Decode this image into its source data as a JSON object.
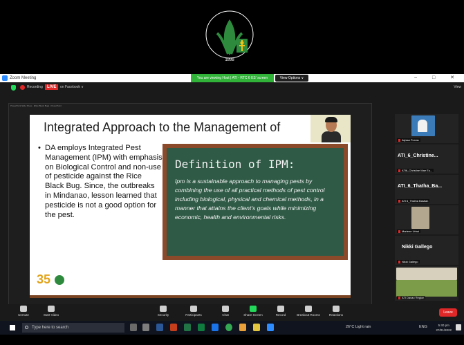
{
  "logo": {
    "text": "DEPARTMENT OF AGRICULTURE",
    "year": "1898"
  },
  "window": {
    "title": "Zoom Meeting",
    "share_banner": "You are viewing Host | ATI - RTC 6 ES' screen",
    "view_options": "View Options ∨",
    "controls": "– □ ✕"
  },
  "recording": {
    "label": "Recording",
    "live": "LIVE",
    "platform": "on Facebook ∨",
    "view": "View"
  },
  "shared_window": {
    "title": "PowerPoint Slide Show - [Rice Black Bug] - PowerPoint",
    "status": "Slide 8 of 11"
  },
  "slide": {
    "title": "Integrated Approach to the Management of",
    "bullet": "DA employs Integrated Pest Management (IPM) with emphasis on Biological Control and non-use of pesticide against the Rice Black Bug. Since, the outbreaks in Mindanao, lesson learned that pesticide is not a good option for the pest.",
    "chalk_heading": "Definition of IPM:",
    "chalk_body": "Ipm is a sustainable approach to managing pests by combining the use of all practical methods of pest control including biological, physical and chemical methods, in a manner that attains the client's goals while minimizing economic, health and environmental risks.",
    "logo_number": "35"
  },
  "gallery": [
    {
      "big_name": "",
      "label": "Alyssa Porras"
    },
    {
      "big_name": "ATI_6_Christine...",
      "label": "ATI6_Christine Mae Eu..."
    },
    {
      "big_name": "ATI_6_Thatha_Ba...",
      "label": "ATI 6_Thatha Bastian"
    },
    {
      "big_name": "",
      "label": "Marlene Urbai"
    },
    {
      "big_name": "Nikki Gallego",
      "label": "Nikki Gallego"
    },
    {
      "big_name": "",
      "label": "ATI Davao Region"
    }
  ],
  "toolbar": {
    "unmute": "Unmute",
    "start_video": "Start Video",
    "security": "Security",
    "participants": "Participants",
    "participants_count": "46",
    "chat": "Chat",
    "share_screen": "Share Screen",
    "record": "Record",
    "breakout": "Breakout Rooms",
    "reactions": "Reactions",
    "leave": "Leave"
  },
  "taskbar": {
    "search_placeholder": "Type here to search",
    "weather": "26°C Light rain",
    "lang": "ENG",
    "time": "5:40 pm",
    "date": "27/01/2022"
  },
  "colors": {
    "zoom_green": "#23d959",
    "live_red": "#e02828",
    "chalkboard": "#2f5a46",
    "frame": "#8b4a2a"
  }
}
